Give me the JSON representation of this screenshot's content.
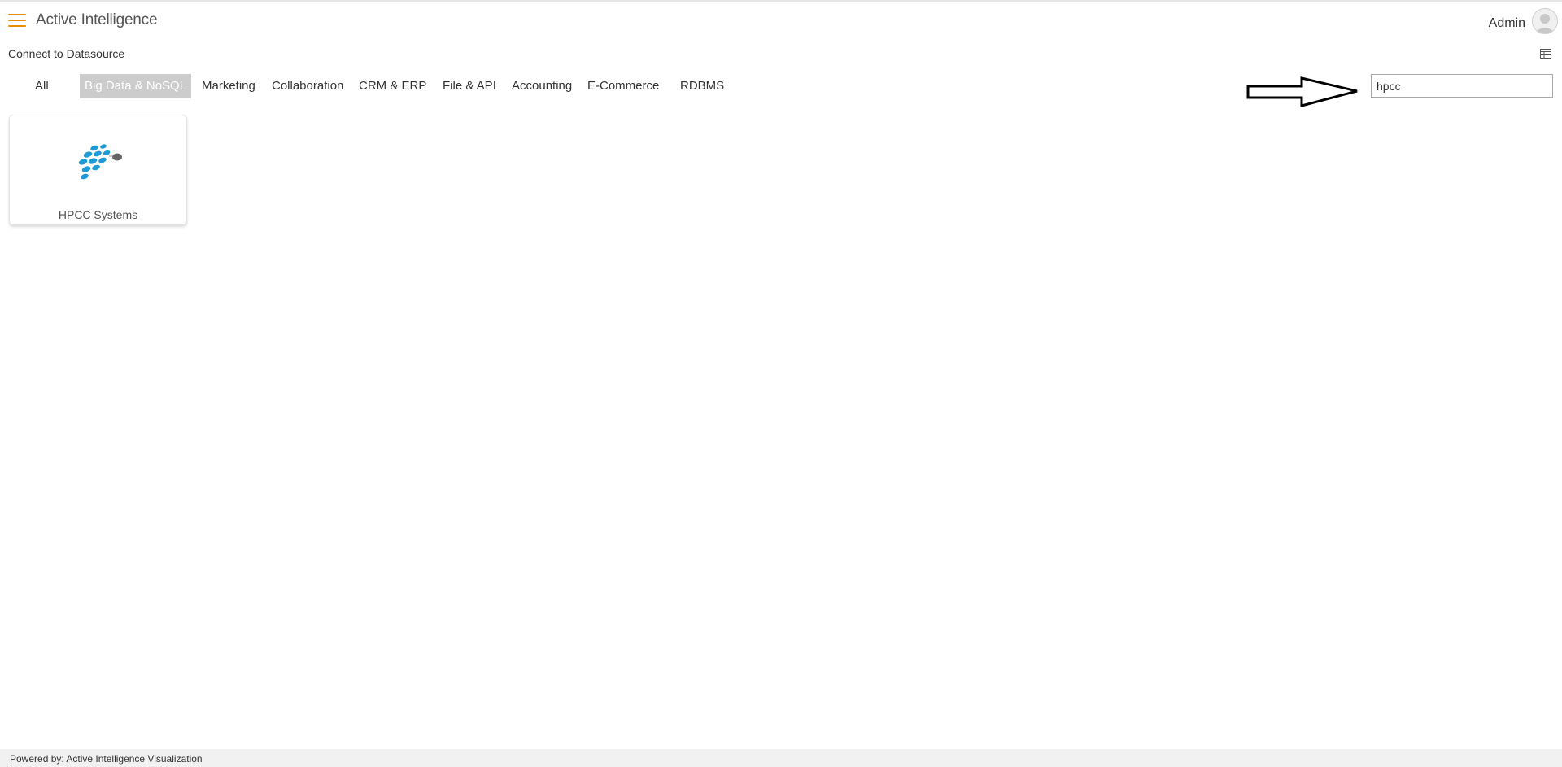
{
  "header": {
    "app_title": "Active Intelligence",
    "user_name": "Admin",
    "accent_color": "#e8900e"
  },
  "page": {
    "heading": "Connect to Datasource"
  },
  "tabs": [
    {
      "label": "All",
      "active": false
    },
    {
      "label": "Big Data & NoSQL",
      "active": true
    },
    {
      "label": "Marketing",
      "active": false
    },
    {
      "label": "Collaboration",
      "active": false
    },
    {
      "label": "CRM & ERP",
      "active": false
    },
    {
      "label": "File & API",
      "active": false
    },
    {
      "label": "Accounting",
      "active": false
    },
    {
      "label": "E-Commerce",
      "active": false
    },
    {
      "label": "RDBMS",
      "active": false
    }
  ],
  "search": {
    "value": "hpcc",
    "placeholder": ""
  },
  "datasources": [
    {
      "label": "HPCC Systems",
      "icon": "hpcc-systems-logo-icon",
      "logo_colors": [
        "#1e9ad6",
        "#666666"
      ]
    }
  ],
  "footer": {
    "text": "Powered by: Active Intelligence Visualization"
  }
}
